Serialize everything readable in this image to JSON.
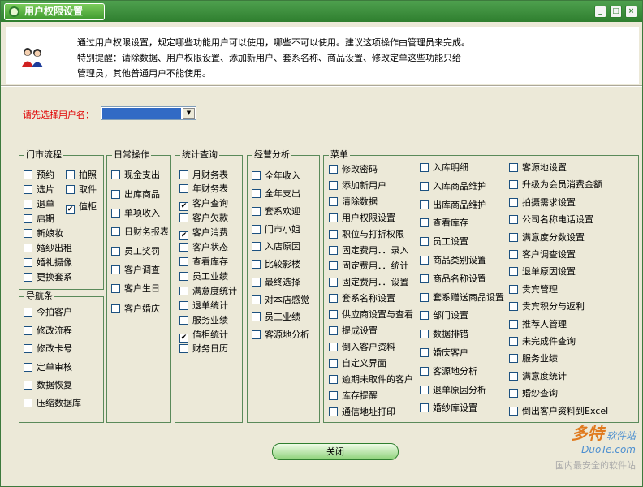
{
  "window": {
    "title": "用户权限设置",
    "buttons": [
      "_",
      "□",
      "×"
    ]
  },
  "notice": {
    "line1": "通过用户权限设置，规定哪些功能用户可以使用，哪些不可以使用。建议这项操作由管理员来完成。",
    "line2": "特别提醒：请除数据、用户权限设置、添加新用户、套系名称、商品设置、修改定单这些功能只给",
    "line3": "管理员，其他普通用户不能使用。"
  },
  "user_select": {
    "label": "请先选择用户名：",
    "value": ""
  },
  "groups": {
    "store": {
      "title": "门市流程",
      "items": [
        {
          "label": "预约",
          "checked": false
        },
        {
          "label": "拍照",
          "checked": false
        },
        {
          "label": "选片",
          "checked": false
        },
        {
          "label": "取件",
          "checked": false
        },
        {
          "label": "退单",
          "checked": false
        },
        {
          "label": "值柜",
          "checked": true
        },
        {
          "label": "启期",
          "checked": false
        },
        {
          "label": "新娘妆",
          "checked": false
        },
        {
          "label": "婚纱出租",
          "checked": false
        },
        {
          "label": "婚礼摄像",
          "checked": false
        },
        {
          "label": "更换套系",
          "checked": false
        }
      ]
    },
    "nav": {
      "title": "导航条",
      "items": [
        {
          "label": "今拍客户",
          "checked": false
        },
        {
          "label": "修改流程",
          "checked": false
        },
        {
          "label": "修改卡号",
          "checked": false
        },
        {
          "label": "定单审核",
          "checked": false
        },
        {
          "label": "数据恢复",
          "checked": false
        },
        {
          "label": "压缩数据库",
          "checked": false
        }
      ]
    },
    "daily": {
      "title": "日常操作",
      "items": [
        {
          "label": "现金支出",
          "checked": false
        },
        {
          "label": "出库商品",
          "checked": false
        },
        {
          "label": "单项收入",
          "checked": false
        },
        {
          "label": "日财务报表",
          "checked": false
        },
        {
          "label": "员工奖罚",
          "checked": false
        },
        {
          "label": "客户调查",
          "checked": false
        },
        {
          "label": "客户生日",
          "checked": false
        },
        {
          "label": "客户婚庆",
          "checked": false
        }
      ]
    },
    "stats": {
      "title": "统计查询",
      "items": [
        {
          "label": "月财务表",
          "checked": false
        },
        {
          "label": "年财务表",
          "checked": false
        },
        {
          "label": "客户查询",
          "checked": true
        },
        {
          "label": "客户欠款",
          "checked": false
        },
        {
          "label": "客户消费",
          "checked": true
        },
        {
          "label": "客户状态",
          "checked": false
        },
        {
          "label": "查看库存",
          "checked": false
        },
        {
          "label": "员工业绩",
          "checked": false
        },
        {
          "label": "满意度统计",
          "checked": false
        },
        {
          "label": "退单统计",
          "checked": false
        },
        {
          "label": "服务业绩",
          "checked": false
        },
        {
          "label": "值柜统计",
          "checked": true
        },
        {
          "label": "财务日历",
          "checked": false
        }
      ]
    },
    "analysis": {
      "title": "经营分析",
      "items": [
        {
          "label": "全年收入",
          "checked": false
        },
        {
          "label": "全年支出",
          "checked": false
        },
        {
          "label": "套系欢迎",
          "checked": false
        },
        {
          "label": "门市小姐",
          "checked": false
        },
        {
          "label": "入店原因",
          "checked": false
        },
        {
          "label": "比较影楼",
          "checked": false
        },
        {
          "label": "最终选择",
          "checked": false
        },
        {
          "label": "对本店感觉",
          "checked": false
        },
        {
          "label": "员工业绩",
          "checked": false
        },
        {
          "label": "客源地分析",
          "checked": false
        }
      ]
    },
    "menu": {
      "title": "菜单",
      "col1": [
        {
          "label": "修改密码",
          "checked": false
        },
        {
          "label": "添加新用户",
          "checked": false
        },
        {
          "label": "清除数据",
          "checked": false
        },
        {
          "label": "用户权限设置",
          "checked": false
        },
        {
          "label": "职位与打折权限",
          "checked": false
        },
        {
          "label": "固定费用．．录入",
          "checked": false
        },
        {
          "label": "固定费用．．统计",
          "checked": false
        },
        {
          "label": "固定费用．．设置",
          "checked": false
        },
        {
          "label": "套系名称设置",
          "checked": false
        },
        {
          "label": "供应商设置与查看",
          "checked": false
        },
        {
          "label": "提成设置",
          "checked": false
        },
        {
          "label": "倒入客户资料",
          "checked": false
        },
        {
          "label": "自定义界面",
          "checked": false
        },
        {
          "label": "逾期未取件的客户",
          "checked": false
        },
        {
          "label": "库存提醒",
          "checked": false
        },
        {
          "label": "通信地址打印",
          "checked": false
        }
      ],
      "col2": [
        {
          "label": "入库明细",
          "checked": false
        },
        {
          "label": "入库商品维护",
          "checked": false
        },
        {
          "label": "出库商品维护",
          "checked": false
        },
        {
          "label": "查看库存",
          "checked": false
        },
        {
          "label": "员工设置",
          "checked": false
        },
        {
          "label": "商品类别设置",
          "checked": false
        },
        {
          "label": "商品名称设置",
          "checked": false
        },
        {
          "label": "套系赠送商品设置",
          "checked": false
        },
        {
          "label": "部门设置",
          "checked": false
        },
        {
          "label": "数据排错",
          "checked": false
        },
        {
          "label": "婚庆客户",
          "checked": false
        },
        {
          "label": "客源地分析",
          "checked": false
        },
        {
          "label": "退单原因分析",
          "checked": false
        },
        {
          "label": "婚纱库设置",
          "checked": false
        }
      ],
      "col3": [
        {
          "label": "客源地设置",
          "checked": false
        },
        {
          "label": "升级为会员消费金额",
          "checked": false
        },
        {
          "label": "拍摄需求设置",
          "checked": false
        },
        {
          "label": "公司名称电话设置",
          "checked": false
        },
        {
          "label": "满意度分数设置",
          "checked": false
        },
        {
          "label": "客户调查设置",
          "checked": false
        },
        {
          "label": "退单原因设置",
          "checked": false
        },
        {
          "label": "贵宾管理",
          "checked": false
        },
        {
          "label": "贵宾积分与返利",
          "checked": false
        },
        {
          "label": "推荐人管理",
          "checked": false
        },
        {
          "label": "未完成件查询",
          "checked": false
        },
        {
          "label": "服务业绩",
          "checked": false
        },
        {
          "label": "满意度统计",
          "checked": false
        },
        {
          "label": "婚纱查询",
          "checked": false
        },
        {
          "label": "倒出客户资料到Excel",
          "checked": false
        }
      ]
    }
  },
  "close_label": "关闭",
  "watermark": {
    "brand": "多特",
    "brand_sub": "软件站",
    "domain": "DuoTe.com",
    "slogan": "国内最安全的软件站"
  }
}
